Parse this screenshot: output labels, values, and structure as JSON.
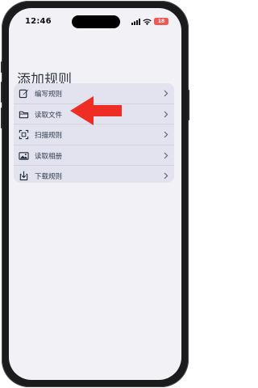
{
  "status_bar": {
    "time": "12:46",
    "battery_level": "18"
  },
  "page": {
    "title": "添加规则"
  },
  "menu": {
    "items": [
      {
        "label": "编写规则",
        "icon": "edit-icon"
      },
      {
        "label": "读取文件",
        "icon": "folder-icon"
      },
      {
        "label": "扫描规则",
        "icon": "scan-icon"
      },
      {
        "label": "读取相册",
        "icon": "photo-album-icon"
      },
      {
        "label": "下载规则",
        "icon": "download-icon"
      }
    ]
  },
  "annotation": {
    "arrow_color": "#ee2e24"
  },
  "colors": {
    "icon": "#1f2a3a",
    "card_bg": "#e3e3ef",
    "chevron": "#5b6472"
  }
}
